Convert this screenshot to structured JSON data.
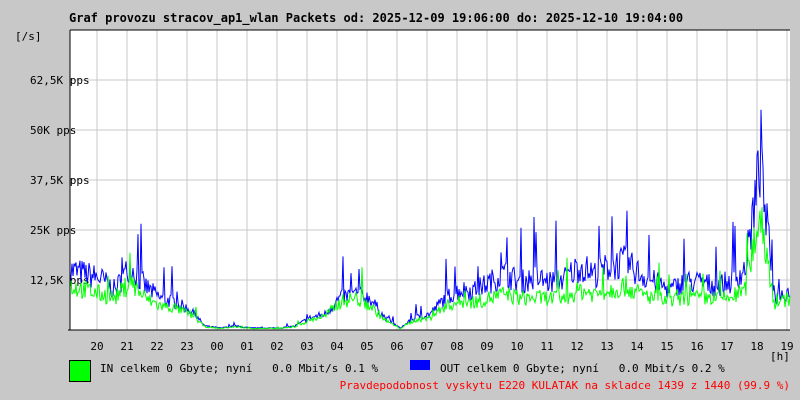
{
  "title": "Graf provozu stracov_ap1_wlan Packets od: 2025-12-09 19:06:00 do: 2025-12-10 19:04:00",
  "legend": {
    "in_text": "IN celkem 0 Gbyte; nyní   0.0 Mbit/s 0.1 %",
    "out_text": "OUT celkem 0 Gbyte; nyní   0.0 Mbit/s 0.2 %",
    "in_color": "#00ff00",
    "out_color": "#0000ff"
  },
  "warning": "Pravdepodobnost vyskytu E220 KULATAK na skladce 1439 z 1440 (99.9 %)",
  "chart_data": {
    "type": "line",
    "title": "Graf provozu stracov_ap1_wlan Packets od: 2025-12-09 19:06:00 do: 2025-12-10 19:04:00",
    "ylabel": "[/s]",
    "xlabel": "[h]",
    "ylim": [
      0,
      75000
    ],
    "yticks": [
      {
        "v": 12500,
        "label": "12,5K pps"
      },
      {
        "v": 25000,
        "label": "25K pps"
      },
      {
        "v": 37500,
        "label": "37,5K pps"
      },
      {
        "v": 50000,
        "label": "50K pps"
      },
      {
        "v": 62500,
        "label": "62,5K pps"
      }
    ],
    "xticks": [
      "20",
      "21",
      "22",
      "23",
      "00",
      "01",
      "02",
      "03",
      "04",
      "05",
      "06",
      "07",
      "08",
      "09",
      "10",
      "11",
      "12",
      "13",
      "14",
      "15",
      "16",
      "17",
      "18",
      "19"
    ],
    "grid": true,
    "x_hours_from_start": [
      0,
      0.5,
      1,
      1.5,
      2,
      2.5,
      3,
      3.5,
      4,
      4.5,
      5,
      5.5,
      6,
      6.5,
      7,
      7.5,
      8,
      8.5,
      9,
      9.5,
      10,
      10.5,
      11,
      11.5,
      12,
      12.5,
      13,
      13.5,
      14,
      14.5,
      15,
      15.5,
      16,
      16.5,
      17,
      17.5,
      18,
      18.5,
      19,
      19.5,
      20,
      20.5,
      21,
      21.5,
      22,
      22.5,
      23,
      23.5,
      24
    ],
    "series": [
      {
        "name": "OUT",
        "color": "#0000ff",
        "values": [
          15000,
          14000,
          13000,
          10000,
          16000,
          11000,
          8000,
          7000,
          5000,
          1000,
          500,
          1000,
          500,
          500,
          500,
          1000,
          3000,
          4000,
          8000,
          9000,
          8000,
          3000,
          500,
          3000,
          4000,
          8000,
          10000,
          10000,
          12000,
          14000,
          12000,
          13000,
          12000,
          13000,
          16000,
          14000,
          16000,
          17000,
          14000,
          12000,
          10000,
          12000,
          12000,
          11000,
          12000,
          15000,
          41000,
          8000,
          10000
        ]
      },
      {
        "name": "IN",
        "color": "#00ff00",
        "values": [
          11000,
          10000,
          9000,
          8000,
          12000,
          8000,
          6000,
          5500,
          4000,
          800,
          400,
          800,
          400,
          400,
          400,
          800,
          2500,
          3500,
          7000,
          8000,
          6000,
          2500,
          400,
          2500,
          3000,
          6000,
          7000,
          7000,
          8000,
          9000,
          8000,
          8000,
          8000,
          8000,
          10000,
          9000,
          10000,
          11000,
          9000,
          8000,
          7000,
          8000,
          8000,
          8000,
          8000,
          10000,
          30000,
          6000,
          8000
        ]
      }
    ]
  }
}
